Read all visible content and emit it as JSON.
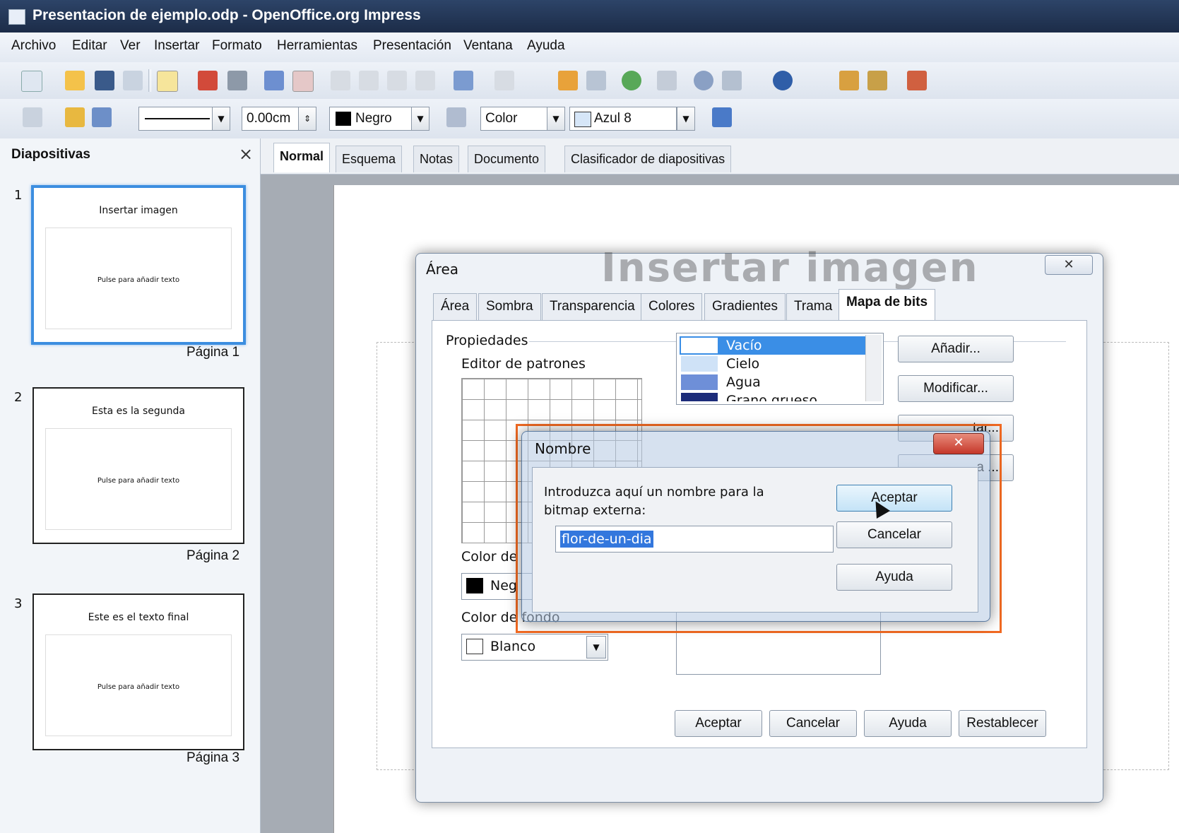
{
  "window": {
    "title": "Presentacion de ejemplo.odp - OpenOffice.org Impress"
  },
  "menu": [
    "Archivo",
    "Editar",
    "Ver",
    "Insertar",
    "Formato",
    "Herramientas",
    "Presentación",
    "Ventana",
    "Ayuda"
  ],
  "toolbar2": {
    "line_width": "0.00cm",
    "line_color": "Negro",
    "area_style": "Color",
    "area_color": "Azul 8"
  },
  "slides_pane": {
    "title": "Diapositivas",
    "slides": [
      {
        "number": "1",
        "title": "Insertar imagen",
        "body": "Pulse para añadir texto",
        "label": "Página 1"
      },
      {
        "number": "2",
        "title": "Esta es la segunda",
        "body": "Pulse para añadir texto",
        "label": "Página 2"
      },
      {
        "number": "3",
        "title": "Este es el texto final",
        "body": "Pulse para añadir texto",
        "label": "Página 3"
      }
    ]
  },
  "view_tabs": [
    "Normal",
    "Esquema",
    "Notas",
    "Documento",
    "Clasificador de diapositivas"
  ],
  "slide_title_behind": "Insertar imagen",
  "area_dialog": {
    "title": "Área",
    "tabs": [
      "Área",
      "Sombra",
      "Transparencia",
      "Colores",
      "Gradientes",
      "Trama",
      "Mapa de bits"
    ],
    "group_label": "Propiedades",
    "pattern_editor_label": "Editor de patrones",
    "fg_color_label": "Color de",
    "fg_color_value": "Neg",
    "bg_color_label": "Color de fondo",
    "bg_color_value": "Blanco",
    "bitmap_list": [
      "Vacío",
      "Cielo",
      "Agua",
      "Grano grueso"
    ],
    "side_buttons": [
      "Añadir...",
      "Modificar...",
      "tar...",
      "a ..."
    ],
    "bottom_buttons": [
      "Aceptar",
      "Cancelar",
      "Ayuda",
      "Restablecer"
    ]
  },
  "name_dialog": {
    "title": "Nombre",
    "prompt": "Introduzca aquí un nombre para la bitmap externa:",
    "value": "flor-de-un-dia",
    "buttons": [
      "Aceptar",
      "Cancelar",
      "Ayuda"
    ]
  }
}
